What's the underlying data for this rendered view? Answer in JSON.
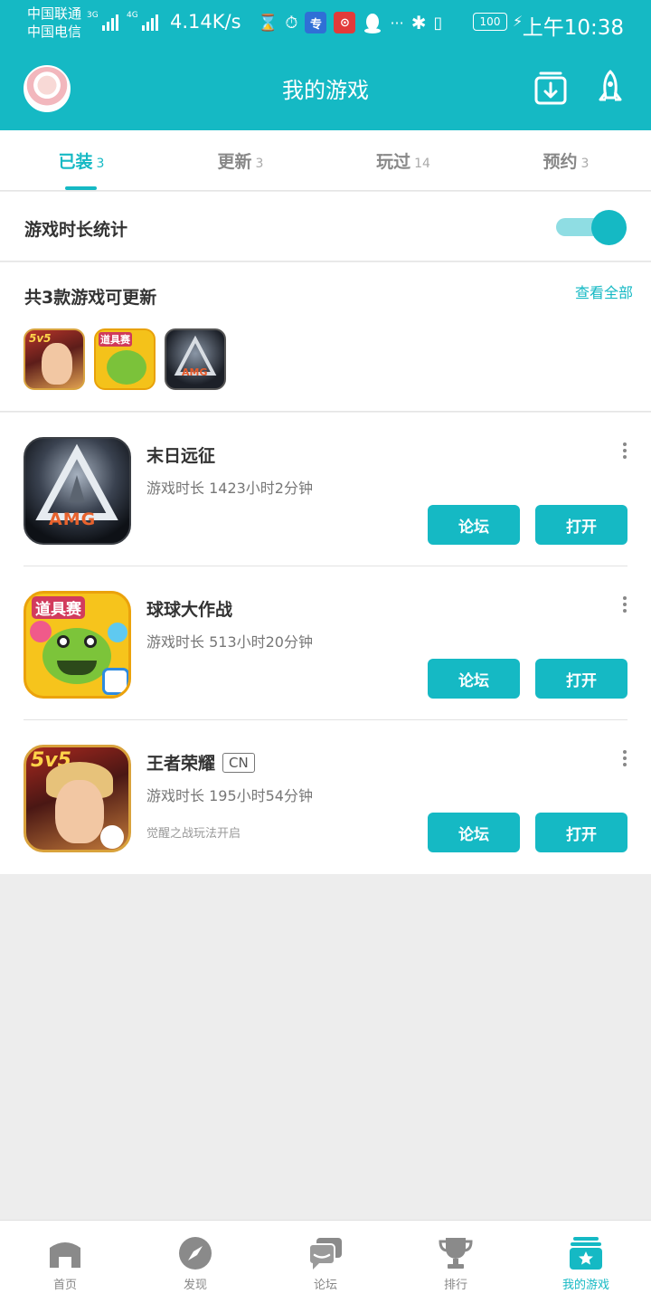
{
  "status_bar": {
    "carrier1": "中国联通",
    "carrier2": "中国电信",
    "net1": "3G",
    "net2": "4G",
    "speed": "4.14K/s",
    "battery": "100",
    "time": "上午10:38"
  },
  "header": {
    "title": "我的游戏",
    "icons": [
      "avatar",
      "download-icon",
      "rocket-icon"
    ]
  },
  "tabs": [
    {
      "label": "已装",
      "count": "3",
      "active": true
    },
    {
      "label": "更新",
      "count": "3",
      "active": false
    },
    {
      "label": "玩过",
      "count": "14",
      "active": false
    },
    {
      "label": "预约",
      "count": "3",
      "active": false
    }
  ],
  "playtime_toggle": {
    "label": "游戏时长统计",
    "enabled": true
  },
  "updates": {
    "title": "共3款游戏可更新",
    "view_all": "查看全部",
    "thumb_texts": [
      "5v5",
      "道具赛",
      "AMG"
    ]
  },
  "games": [
    {
      "name": "末日远征",
      "time": "游戏时长 1423小时2分钟",
      "tag": "",
      "note": "",
      "icon_text": "AMG",
      "forum": "论坛",
      "open": "打开"
    },
    {
      "name": "球球大作战",
      "time": "游戏时长 513小时20分钟",
      "tag": "",
      "note": "",
      "icon_text": "道具赛",
      "forum": "论坛",
      "open": "打开"
    },
    {
      "name": "王者荣耀",
      "time": "游戏时长 195小时54分钟",
      "tag": "CN",
      "note": "觉醒之战玩法开启",
      "icon_text": "5v5",
      "forum": "论坛",
      "open": "打开"
    }
  ],
  "bottom_nav": [
    {
      "label": "首页",
      "icon": "home-icon"
    },
    {
      "label": "发现",
      "icon": "compass-icon"
    },
    {
      "label": "论坛",
      "icon": "chat-icon"
    },
    {
      "label": "排行",
      "icon": "trophy-icon"
    },
    {
      "label": "我的游戏",
      "icon": "my-games-icon",
      "active": true
    }
  ],
  "colors": {
    "accent": "#15b9c4",
    "background": "#ededed"
  }
}
